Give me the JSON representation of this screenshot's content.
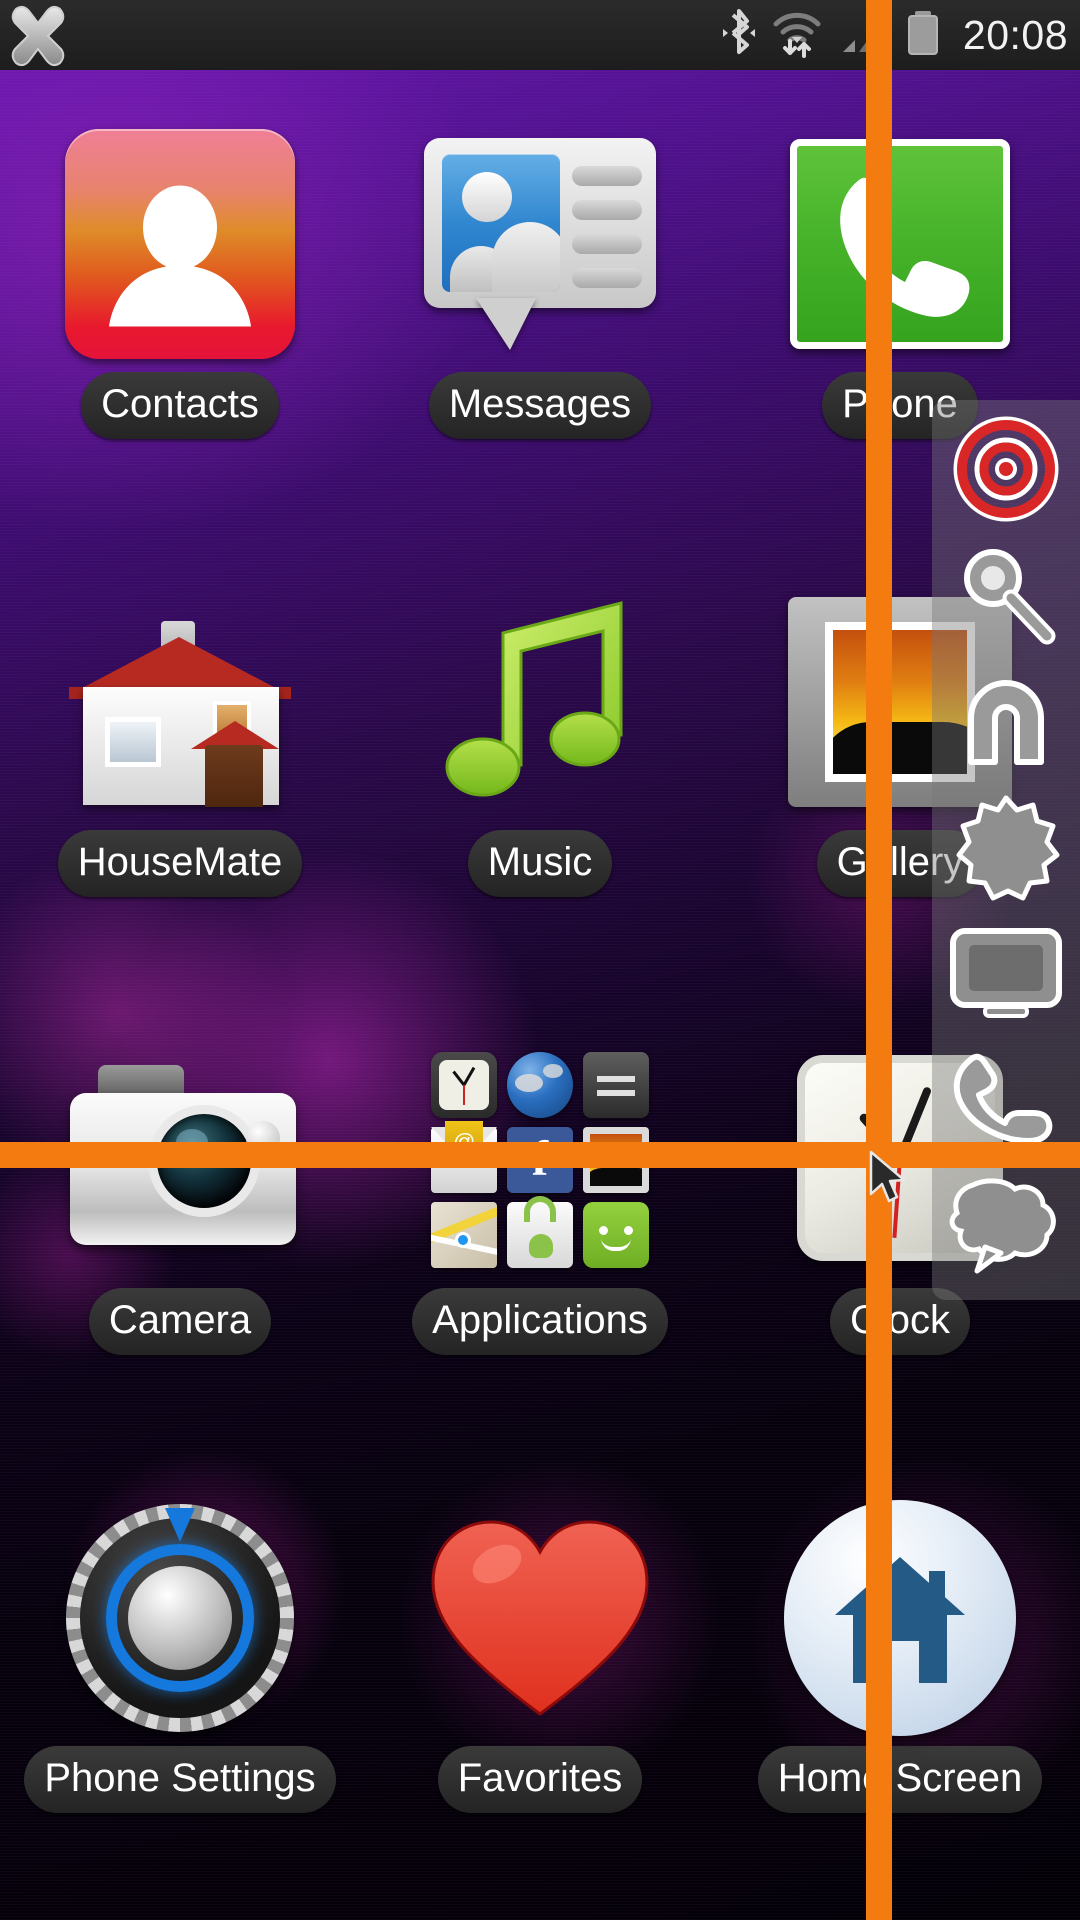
{
  "status_bar": {
    "close_icon": "close-x-icon",
    "bluetooth_icon": "bluetooth-icon",
    "wifi_icon": "wifi-data-icon",
    "signal_icon": "cellular-signal-icon",
    "battery_icon": "battery-icon",
    "clock": "20:08"
  },
  "home_screen": {
    "apps": [
      {
        "label": "Contacts",
        "icon": "contacts-icon"
      },
      {
        "label": "Messages",
        "icon": "messages-icon"
      },
      {
        "label": "Phone",
        "icon": "phone-icon"
      },
      {
        "label": "HouseMate",
        "icon": "housemate-icon"
      },
      {
        "label": "Music",
        "icon": "music-icon"
      },
      {
        "label": "Gallery",
        "icon": "gallery-icon"
      },
      {
        "label": "Camera",
        "icon": "camera-icon"
      },
      {
        "label": "Applications",
        "icon": "applications-folder-icon"
      },
      {
        "label": "Clock",
        "icon": "clock-icon"
      },
      {
        "label": "Phone Settings",
        "icon": "settings-gear-icon"
      },
      {
        "label": "Favorites",
        "icon": "heart-icon"
      },
      {
        "label": "Home Screen",
        "icon": "home-icon"
      }
    ],
    "applications_folder_items": [
      "clock-mini-icon",
      "browser-globe-mini-icon",
      "equalizer-mini-icon",
      "email-mini-icon",
      "facebook-mini-icon",
      "photos-mini-icon",
      "maps-mini-icon",
      "play-store-mini-icon",
      "sms-mini-icon"
    ]
  },
  "side_panel": {
    "items": [
      "target-bullseye-icon",
      "magnifier-icon",
      "magnet-icon",
      "starburst-icon",
      "screen-icon",
      "handset-icon",
      "speech-bubble-icon"
    ]
  },
  "overlay": {
    "crosshair_color": "#f47b10",
    "cursor_icon": "mouse-pointer-icon"
  },
  "colors": {
    "accent_orange": "#f47b10",
    "status_bar_bg": "#222222",
    "label_bg": "#2f2f2f",
    "wallpaper_purple": "#6a17b4"
  }
}
